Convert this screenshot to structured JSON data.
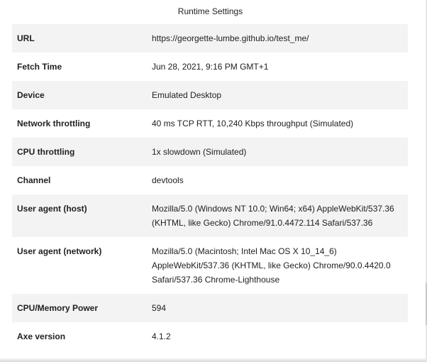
{
  "title": "Runtime Settings",
  "rows": [
    {
      "key": "URL",
      "value": "https://georgette-lumbe.github.io/test_me/"
    },
    {
      "key": "Fetch Time",
      "value": "Jun 28, 2021, 9:16 PM GMT+1"
    },
    {
      "key": "Device",
      "value": "Emulated Desktop"
    },
    {
      "key": "Network throttling",
      "value": "40 ms TCP RTT, 10,240 Kbps throughput (Simulated)"
    },
    {
      "key": "CPU throttling",
      "value": "1x slowdown (Simulated)"
    },
    {
      "key": "Channel",
      "value": "devtools"
    },
    {
      "key": "User agent (host)",
      "value": "Mozilla/5.0 (Windows NT 10.0; Win64; x64) AppleWebKit/537.36 (KHTML, like Gecko) Chrome/91.0.4472.114 Safari/537.36"
    },
    {
      "key": "User agent (network)",
      "value": "Mozilla/5.0 (Macintosh; Intel Mac OS X 10_14_6) AppleWebKit/537.36 (KHTML, like Gecko) Chrome/90.0.4420.0 Safari/537.36 Chrome-Lighthouse"
    },
    {
      "key": "CPU/Memory Power",
      "value": "594"
    },
    {
      "key": "Axe version",
      "value": "4.1.2"
    }
  ]
}
